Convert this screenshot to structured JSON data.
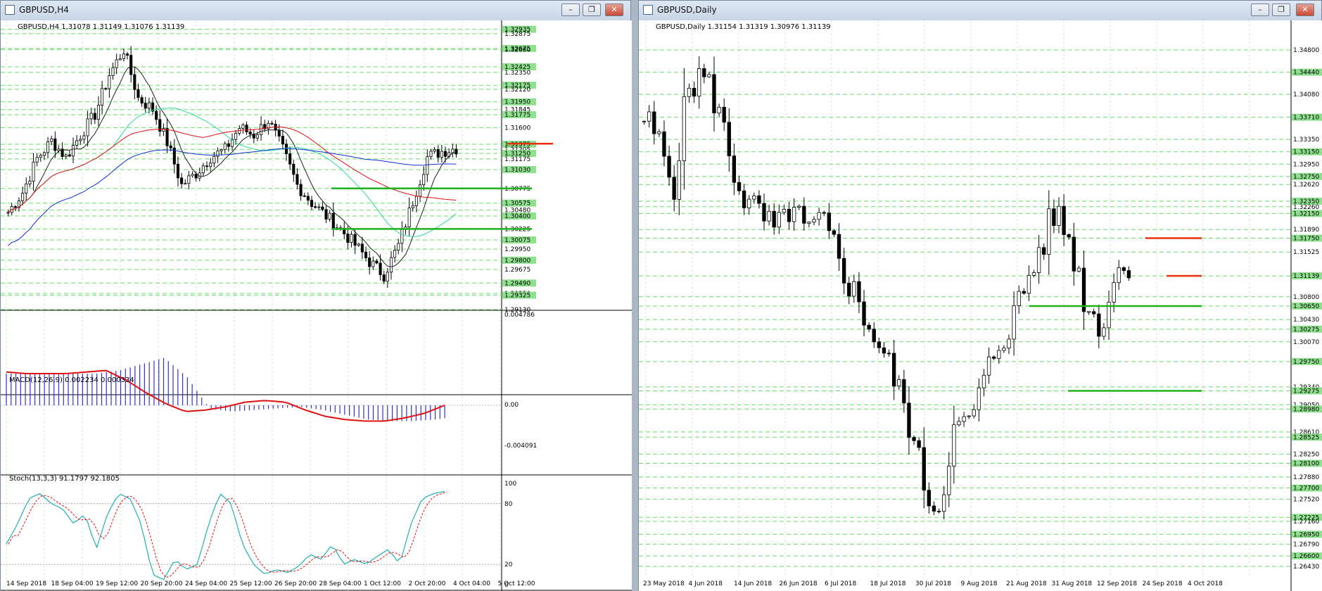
{
  "left_window": {
    "title": "GBPUSD,H4",
    "price_header": "GBPUSD,H4  1.31078 1.31149 1.31076 1.31139",
    "price_labels": [
      "1.32935",
      "1.32875",
      "1.32675",
      "1.32660",
      "1.32425",
      "1.32350",
      "1.32175",
      "1.32120",
      "1.31950",
      "1.31845",
      "1.31775",
      "1.31600",
      "1.31375",
      "1.31305",
      "1.31250",
      "1.31175",
      "1.31030",
      "1.30775",
      "1.30575",
      "1.30480",
      "1.30400",
      "1.30225",
      "1.30075",
      "1.29950",
      "1.29800",
      "1.29675",
      "1.29490",
      "1.29350",
      "1.29325",
      "1.29130"
    ],
    "macd_header": "MACD(12,26,9) 0.002234 0.000334",
    "macd_ticks": [
      "0.004786",
      "0.00",
      "-0.004091"
    ],
    "stoch_header": "Stoch(13,3,3) 91.1797 92.1805",
    "stoch_ticks": [
      "100",
      "80",
      "20",
      "0"
    ],
    "dates": [
      "14 Sep 2018",
      "18 Sep 04:00",
      "19 Sep 12:00",
      "20 Sep 20:00",
      "24 Sep 04:00",
      "25 Sep 12:00",
      "26 Sep 20:00",
      "28 Sep 04:00",
      "1 Oct 12:00",
      "2 Oct 20:00",
      "4 Oct 04:00",
      "5 Oct 12:00"
    ]
  },
  "right_window": {
    "title": "GBPUSD,Daily",
    "price_header": "GBPUSD,Daily  1.31154 1.31319 1.30976 1.31139",
    "price_labels": [
      "1.34800",
      "1.34440",
      "1.34080",
      "1.33710",
      "1.33350",
      "1.33150",
      "1.32950",
      "1.32750",
      "1.32620",
      "1.32350",
      "1.32260",
      "1.32150",
      "1.31890",
      "1.31750",
      "1.31525",
      "1.31139",
      "1.30800",
      "1.30650",
      "1.30430",
      "1.30275",
      "1.30070",
      "1.29750",
      "1.29340",
      "1.29275",
      "1.29050",
      "1.28980",
      "1.28610",
      "1.28525",
      "1.28250",
      "1.28100",
      "1.27880",
      "1.27700",
      "1.27520",
      "1.27225",
      "1.27160",
      "1.26950",
      "1.26790",
      "1.26600",
      "1.26430"
    ],
    "dates": [
      "23 May 2018",
      "4 Jun 2018",
      "14 Jun 2018",
      "26 Jun 2018",
      "6 Jul 2018",
      "18 Jul 2018",
      "30 Jul 2018",
      "9 Aug 2018",
      "21 Aug 2018",
      "31 Aug 2018",
      "12 Sep 2018",
      "24 Sep 2018",
      "4 Oct 2018"
    ]
  },
  "colors": {
    "green_level": "#1fb21f",
    "red_level": "#e8300a",
    "ma_red": "#e01010",
    "ma_blue": "#1030d0",
    "ma_aqua": "#30d8a0",
    "ma_black": "#202020",
    "macd_hist": "#3030d0",
    "signal": "#e01010",
    "stoch_main": "#20b0b0",
    "stoch_signal": "#e01010",
    "dashed": "#66dd66"
  },
  "chart_data": [
    {
      "type": "line",
      "title": "GBPUSD,H4",
      "ylim": [
        1.2913,
        1.3296
      ],
      "series": [
        {
          "values": [
            1.3045,
            1.3072,
            1.3118,
            1.3142,
            1.312,
            1.315,
            1.3178,
            1.3232,
            1.3266,
            1.32,
            1.3185,
            1.314,
            1.3082,
            1.3098,
            1.312,
            1.313,
            1.316,
            1.315,
            1.317,
            1.313,
            1.3082,
            1.3058,
            1.304,
            1.3022,
            1.3001,
            1.2978,
            1.296,
            1.3,
            1.306,
            1.312,
            1.3128,
            1.3132
          ]
        }
      ],
      "levels": {
        "green": [
          1.30775,
          1.30225
        ],
        "red": [
          1.31305
        ]
      }
    },
    {
      "type": "line",
      "title": "GBPUSD,Daily",
      "ylim": [
        1.2643,
        1.3496
      ],
      "series": [
        {
          "values": [
            1.337,
            1.333,
            1.326,
            1.342,
            1.344,
            1.339,
            1.329,
            1.323,
            1.321,
            1.318,
            1.323,
            1.318,
            1.32,
            1.316,
            1.31,
            1.305,
            1.3,
            1.295,
            1.288,
            1.278,
            1.273,
            1.286,
            1.287,
            1.293,
            1.3,
            1.304,
            1.31,
            1.316,
            1.322,
            1.317,
            1.3075,
            1.303,
            1.311,
            1.3139
          ]
        }
      ],
      "levels": {
        "green": [
          1.3065,
          1.29275
        ],
        "red": [
          1.3175,
          1.31139
        ]
      }
    }
  ]
}
